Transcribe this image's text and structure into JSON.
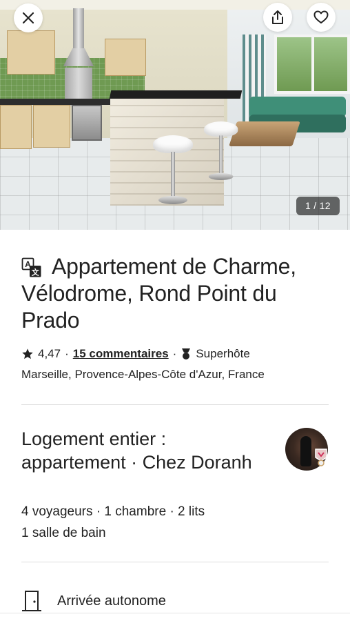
{
  "hero": {
    "photo_counter": "1 / 12"
  },
  "listing": {
    "title": "Appartement de Charme, Vélodrome, Rond Point du Prado",
    "rating": "4,47",
    "reviews_link": "15 commentaires",
    "superhost": "Superhôte",
    "location": "Marseille, Provence-Alpes-Côte d'Azur, France"
  },
  "host_section": {
    "title": "Logement entier : appartement · Chez Doranh",
    "details_line1": "4 voyageurs · 1 chambre · 2 lits",
    "details_line2": "1 salle de bain"
  },
  "features": [
    {
      "icon": "door-icon",
      "label": "Arrivée autonome"
    }
  ],
  "icons": {
    "close": "close-icon",
    "share": "share-icon",
    "favorite": "heart-icon",
    "translate": "translate-icon",
    "star": "star-icon",
    "superhost": "medal-icon"
  },
  "colors": {
    "text": "#222222",
    "divider": "#dddddd",
    "counter_bg": "#222222"
  }
}
